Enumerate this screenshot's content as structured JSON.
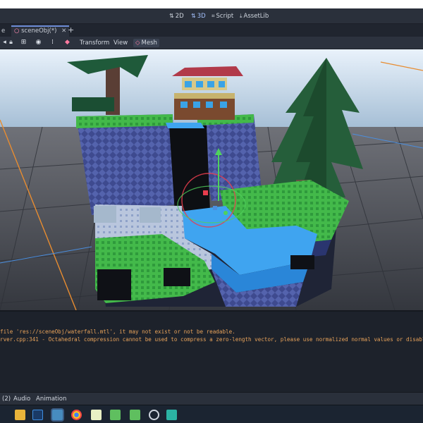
{
  "modes": {
    "btn_2d": "2D",
    "btn_3d": "3D",
    "btn_script": "Script",
    "btn_assetlib": "AssetLib"
  },
  "tabs": {
    "prev_tab_fragment": "e",
    "current_tab": "sceneObj(*)",
    "close_glyph": "✕",
    "add_glyph": "+"
  },
  "toolbar": {
    "transform": "Transform",
    "view": "View",
    "mesh": "Mesh"
  },
  "output": {
    "line1": "file 'res://sceneObj/waterfall.mtl', it may not exist or not be readable.",
    "line2": "rver.cpp:341 - Octahedral compression cannot be used to compress a zero-length vector, please use normalized normal values or disable oc"
  },
  "bottom_tabs": {
    "debugger_fragment": "(2)",
    "audio": "Audio",
    "animation": "Animation"
  },
  "colors": {
    "editor_bg": "#242a35",
    "output_text": "#e7a25a",
    "active_mode": "#a6c3ff",
    "water": "#3fa4f0",
    "grass": "#43b94a"
  },
  "taskbar": {
    "apps": [
      "file-explorer-icon",
      "photoshop-icon",
      "godot-icon",
      "chrome-icon",
      "notepad-icon",
      "godot-icon",
      "godot-icon",
      "clock-icon",
      "media-icon"
    ]
  }
}
